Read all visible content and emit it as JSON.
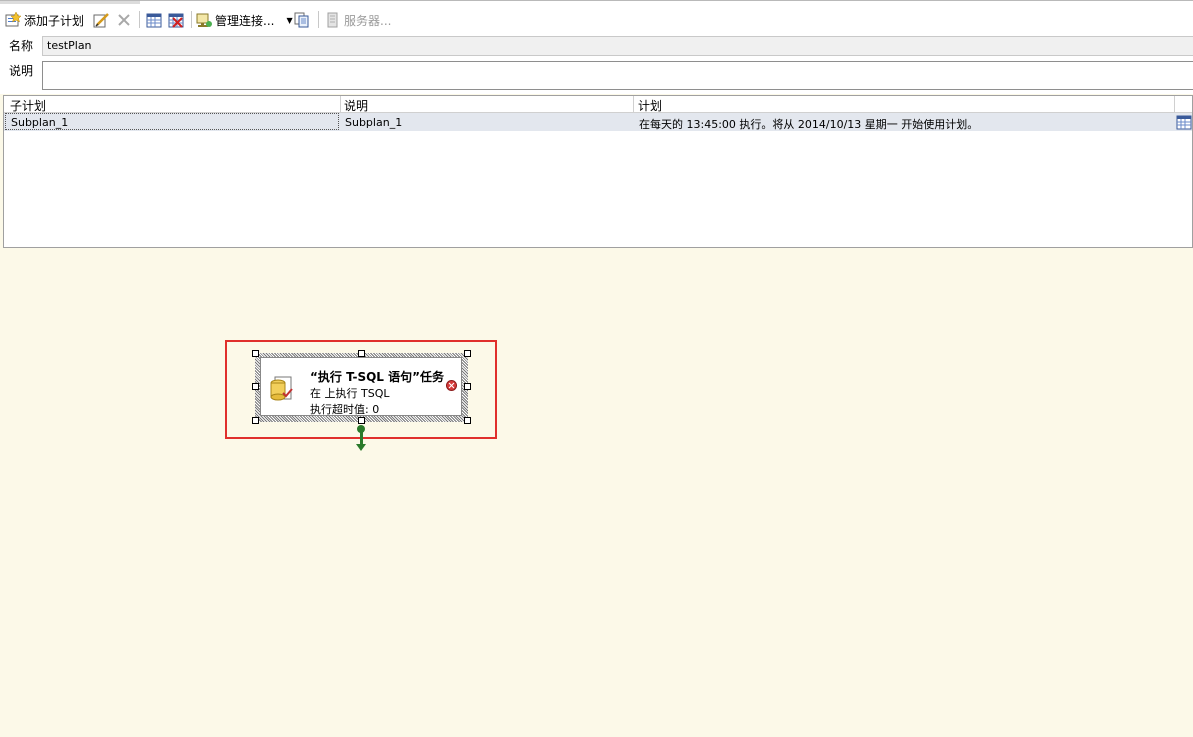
{
  "toolbar": {
    "add_subplan_label": "添加子计划",
    "manage_connections_label": "管理连接...",
    "servers_label": "服务器..."
  },
  "properties": {
    "name_label": "名称",
    "name_value": "testPlan",
    "description_label": "说明",
    "description_value": ""
  },
  "subplans": {
    "columns": [
      "子计划",
      "说明",
      "计划"
    ],
    "rows": [
      {
        "subplan": "Subplan_1",
        "description": "Subplan_1",
        "schedule": "在每天的 13:45:00 执行。将从 2014/10/13 星期一 开始使用计划。"
      }
    ]
  },
  "designer": {
    "task": {
      "title": "“执行 T-SQL 语句”任务",
      "line1": "在  上执行 TSQL",
      "line2": "执行超时值: 0"
    }
  },
  "colors": {
    "designer_bg": "#fcf9e8",
    "highlight": "#e0302c",
    "connector": "#2a7a2a",
    "row_bg": "#e3e7ee"
  }
}
